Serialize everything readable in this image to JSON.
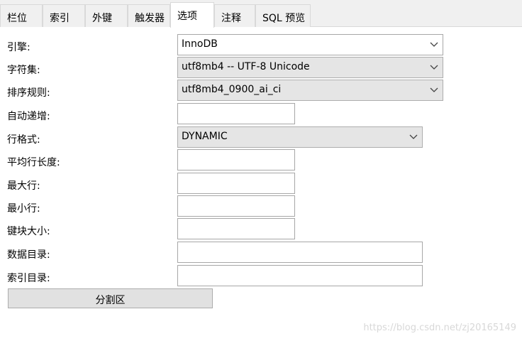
{
  "tabs": [
    "栏位",
    "索引",
    "外键",
    "触发器",
    "选项",
    "注释",
    "SQL 预览"
  ],
  "active_tab_index": 4,
  "form": {
    "engine_label": "引擎:",
    "engine_value": "InnoDB",
    "charset_label": "字符集:",
    "charset_value": "utf8mb4 -- UTF-8 Unicode",
    "collation_label": "排序规则:",
    "collation_value": "utf8mb4_0900_ai_ci",
    "auto_increment_label": "自动递增:",
    "auto_increment_value": "",
    "row_format_label": "行格式:",
    "row_format_value": "DYNAMIC",
    "avg_row_length_label": "平均行长度:",
    "avg_row_length_value": "",
    "max_rows_label": "最大行:",
    "max_rows_value": "",
    "min_rows_label": "最小行:",
    "min_rows_value": "",
    "key_block_size_label": "键块大小:",
    "key_block_size_value": "",
    "data_directory_label": "数据目录:",
    "data_directory_value": "",
    "index_directory_label": "索引目录:",
    "index_directory_value": "",
    "partition_button_label": "分割区"
  },
  "watermark": "https://blog.csdn.net/zj20165149",
  "icons": {
    "dropdown": "chevron-down-icon"
  }
}
